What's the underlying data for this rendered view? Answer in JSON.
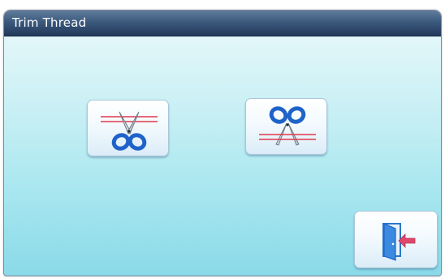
{
  "dialog": {
    "title": "Trim Thread"
  },
  "buttons": [
    {
      "id": "trim-upper",
      "icon": "scissors-thread-upper-icon"
    },
    {
      "id": "trim-lower",
      "icon": "scissors-thread-lower-icon"
    },
    {
      "id": "exit",
      "icon": "exit-door-icon"
    }
  ],
  "colors": {
    "titlebar": "#2f4b6e",
    "background_top": "#ecf9fb",
    "background_bottom": "#8ad9e8",
    "scissors_handle": "#1f63c9",
    "thread_line": "#e0394a",
    "exit_arrow": "#e0476b"
  }
}
